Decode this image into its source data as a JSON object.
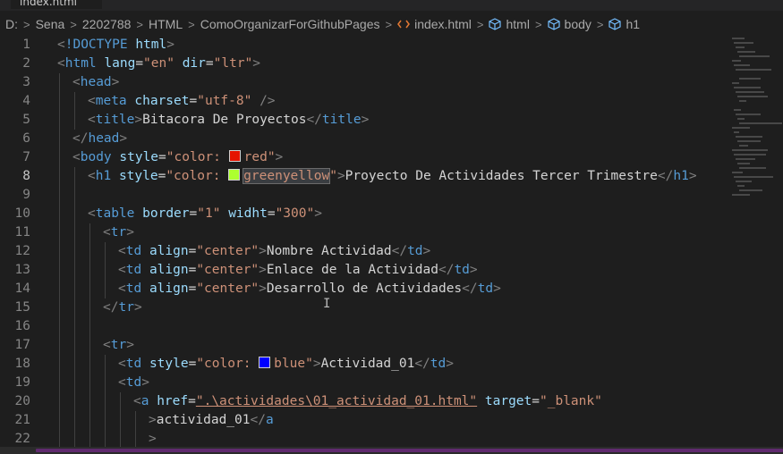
{
  "tab": {
    "label": "index.html"
  },
  "breadcrumb": [
    {
      "label": "D:",
      "icon": ""
    },
    {
      "label": "Sena",
      "icon": ""
    },
    {
      "label": "2202788",
      "icon": ""
    },
    {
      "label": "HTML",
      "icon": ""
    },
    {
      "label": "ComoOrganizarForGithubPages",
      "icon": ""
    },
    {
      "label": "index.html",
      "icon": "html-file-icon"
    },
    {
      "label": "html",
      "icon": "element-icon"
    },
    {
      "label": "body",
      "icon": "element-icon"
    },
    {
      "label": "h1",
      "icon": "element-icon"
    }
  ],
  "editor": {
    "current_line": 8,
    "lines": [
      {
        "n": "1",
        "indent": 0,
        "tokens": [
          [
            "p",
            "<"
          ],
          [
            "t",
            "!DOCTYPE"
          ],
          [
            "s",
            " "
          ],
          [
            "a",
            "html"
          ],
          [
            "p",
            ">"
          ]
        ]
      },
      {
        "n": "2",
        "indent": 0,
        "tokens": [
          [
            "p",
            "<"
          ],
          [
            "t",
            "html"
          ],
          [
            "s",
            " "
          ],
          [
            "a",
            "lang"
          ],
          [
            "s",
            "="
          ],
          [
            "v",
            "\"en\""
          ],
          [
            "s",
            " "
          ],
          [
            "a",
            "dir"
          ],
          [
            "s",
            "="
          ],
          [
            "v",
            "\"ltr\""
          ],
          [
            "p",
            ">"
          ]
        ]
      },
      {
        "n": "3",
        "indent": 1,
        "tokens": [
          [
            "p",
            "<"
          ],
          [
            "t",
            "head"
          ],
          [
            "p",
            ">"
          ]
        ]
      },
      {
        "n": "4",
        "indent": 2,
        "tokens": [
          [
            "p",
            "<"
          ],
          [
            "t",
            "meta"
          ],
          [
            "s",
            " "
          ],
          [
            "a",
            "charset"
          ],
          [
            "s",
            "="
          ],
          [
            "v",
            "\"utf-8\""
          ],
          [
            "s",
            " "
          ],
          [
            "p",
            "/>"
          ]
        ]
      },
      {
        "n": "5",
        "indent": 2,
        "tokens": [
          [
            "p",
            "<"
          ],
          [
            "t",
            "title"
          ],
          [
            "p",
            ">"
          ],
          [
            "txt",
            "Bitacora De Proyectos"
          ],
          [
            "p",
            "</"
          ],
          [
            "t",
            "title"
          ],
          [
            "p",
            ">"
          ]
        ]
      },
      {
        "n": "6",
        "indent": 1,
        "tokens": [
          [
            "p",
            "</"
          ],
          [
            "t",
            "head"
          ],
          [
            "p",
            ">"
          ]
        ]
      },
      {
        "n": "7",
        "indent": 1,
        "tokens": [
          [
            "p",
            "<"
          ],
          [
            "t",
            "body"
          ],
          [
            "s",
            " "
          ],
          [
            "a",
            "style"
          ],
          [
            "s",
            "="
          ],
          [
            "v",
            "\"color: "
          ],
          [
            "swatch",
            "#e51400"
          ],
          [
            "v",
            "red\""
          ],
          [
            "p",
            ">"
          ]
        ]
      },
      {
        "n": "8",
        "indent": 2,
        "tokens": [
          [
            "p",
            "<"
          ],
          [
            "t",
            "h1"
          ],
          [
            "s",
            " "
          ],
          [
            "a",
            "style"
          ],
          [
            "s",
            "="
          ],
          [
            "v",
            "\"color: "
          ],
          [
            "swatch",
            "#adff2f"
          ],
          [
            "vsel",
            "greenyellow"
          ],
          [
            "v",
            "\""
          ],
          [
            "p",
            ">"
          ],
          [
            "txt",
            "Proyecto De Actividades Tercer Trimestre"
          ],
          [
            "p",
            "</"
          ],
          [
            "t",
            "h1"
          ],
          [
            "p",
            ">"
          ]
        ]
      },
      {
        "n": "9",
        "indent": 2,
        "tokens": []
      },
      {
        "n": "10",
        "indent": 2,
        "tokens": [
          [
            "p",
            "<"
          ],
          [
            "t",
            "table"
          ],
          [
            "s",
            " "
          ],
          [
            "a",
            "border"
          ],
          [
            "s",
            "="
          ],
          [
            "v",
            "\"1\""
          ],
          [
            "s",
            " "
          ],
          [
            "a",
            "widht"
          ],
          [
            "s",
            "="
          ],
          [
            "v",
            "\"300\""
          ],
          [
            "p",
            ">"
          ]
        ]
      },
      {
        "n": "11",
        "indent": 3,
        "tokens": [
          [
            "p",
            "<"
          ],
          [
            "t",
            "tr"
          ],
          [
            "p",
            ">"
          ]
        ]
      },
      {
        "n": "12",
        "indent": 4,
        "tokens": [
          [
            "p",
            "<"
          ],
          [
            "t",
            "td"
          ],
          [
            "s",
            " "
          ],
          [
            "a",
            "align"
          ],
          [
            "s",
            "="
          ],
          [
            "v",
            "\"center\""
          ],
          [
            "p",
            ">"
          ],
          [
            "txt",
            "Nombre Actividad"
          ],
          [
            "p",
            "</"
          ],
          [
            "t",
            "td"
          ],
          [
            "p",
            ">"
          ]
        ]
      },
      {
        "n": "13",
        "indent": 4,
        "tokens": [
          [
            "p",
            "<"
          ],
          [
            "t",
            "td"
          ],
          [
            "s",
            " "
          ],
          [
            "a",
            "align"
          ],
          [
            "s",
            "="
          ],
          [
            "v",
            "\"center\""
          ],
          [
            "p",
            ">"
          ],
          [
            "txt",
            "Enlace de la Actividad"
          ],
          [
            "p",
            "</"
          ],
          [
            "t",
            "td"
          ],
          [
            "p",
            ">"
          ]
        ]
      },
      {
        "n": "14",
        "indent": 4,
        "tokens": [
          [
            "p",
            "<"
          ],
          [
            "t",
            "td"
          ],
          [
            "s",
            " "
          ],
          [
            "a",
            "align"
          ],
          [
            "s",
            "="
          ],
          [
            "v",
            "\"center\""
          ],
          [
            "p",
            ">"
          ],
          [
            "txt",
            "Desarrollo de Actividades"
          ],
          [
            "p",
            "</"
          ],
          [
            "t",
            "td"
          ],
          [
            "p",
            ">"
          ]
        ]
      },
      {
        "n": "15",
        "indent": 3,
        "tokens": [
          [
            "p",
            "</"
          ],
          [
            "t",
            "tr"
          ],
          [
            "p",
            ">"
          ]
        ]
      },
      {
        "n": "16",
        "indent": 3,
        "tokens": []
      },
      {
        "n": "17",
        "indent": 3,
        "tokens": [
          [
            "p",
            "<"
          ],
          [
            "t",
            "tr"
          ],
          [
            "p",
            ">"
          ]
        ]
      },
      {
        "n": "18",
        "indent": 4,
        "tokens": [
          [
            "p",
            "<"
          ],
          [
            "t",
            "td"
          ],
          [
            "s",
            " "
          ],
          [
            "a",
            "style"
          ],
          [
            "s",
            "="
          ],
          [
            "v",
            "\"color: "
          ],
          [
            "swatch",
            "#0000ff"
          ],
          [
            "v",
            "blue\""
          ],
          [
            "p",
            ">"
          ],
          [
            "txt",
            "Actividad_01"
          ],
          [
            "p",
            "</"
          ],
          [
            "t",
            "td"
          ],
          [
            "p",
            ">"
          ]
        ]
      },
      {
        "n": "19",
        "indent": 4,
        "tokens": [
          [
            "p",
            "<"
          ],
          [
            "t",
            "td"
          ],
          [
            "p",
            ">"
          ]
        ]
      },
      {
        "n": "20",
        "indent": 5,
        "tokens": [
          [
            "p",
            "<"
          ],
          [
            "t",
            "a"
          ],
          [
            "s",
            " "
          ],
          [
            "a",
            "href"
          ],
          [
            "s",
            "="
          ],
          [
            "vu",
            "\".\\actividades\\01_actividad_01.html\""
          ],
          [
            "s",
            " "
          ],
          [
            "a",
            "target"
          ],
          [
            "s",
            "="
          ],
          [
            "v",
            "\"_blank\""
          ]
        ]
      },
      {
        "n": "21",
        "indent": 6,
        "tokens": [
          [
            "p",
            ">"
          ],
          [
            "txt",
            "actividad_01"
          ],
          [
            "p",
            "</"
          ],
          [
            "t",
            "a"
          ]
        ]
      },
      {
        "n": "22",
        "indent": 6,
        "tokens": [
          [
            "p",
            ">"
          ]
        ]
      }
    ]
  }
}
